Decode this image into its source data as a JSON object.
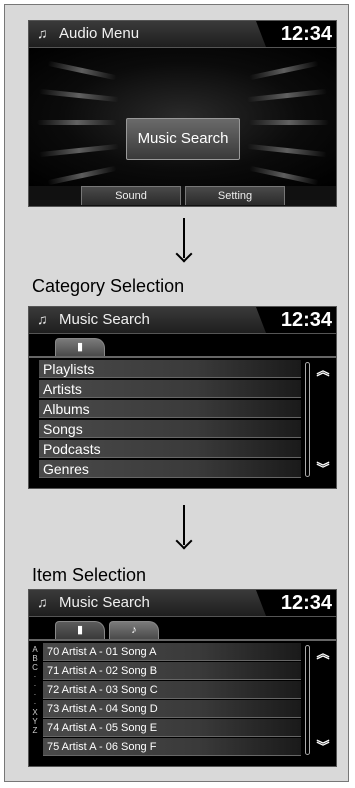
{
  "clock": "12:34",
  "screen1": {
    "title": "Audio Menu",
    "center_button": "Music Search",
    "softkeys": [
      "Sound",
      "Setting"
    ]
  },
  "caption_category": "Category Selection",
  "screen2": {
    "title": "Music Search",
    "items": [
      "Playlists",
      "Artists",
      "Albums",
      "Songs",
      "Podcasts",
      "Genres"
    ]
  },
  "caption_item": "Item Selection",
  "screen3": {
    "title": "Music Search",
    "items": [
      "70 Artist A - 01 Song A",
      "71 Artist A - 02 Song B",
      "72 Artist A - 03 Song C",
      "73 Artist A - 04 Song D",
      "74 Artist A - 05 Song E",
      "75 Artist A - 06 Song F"
    ],
    "alpha_index": [
      "A",
      "B",
      "C",
      "·",
      "·",
      "·",
      "·",
      "X",
      "Y",
      "Z"
    ]
  },
  "icons": {
    "music_note": "music-note-icon",
    "ipod": "ipod-icon",
    "scroll_up": "chevron-up-icon",
    "scroll_down": "chevron-down-icon"
  }
}
